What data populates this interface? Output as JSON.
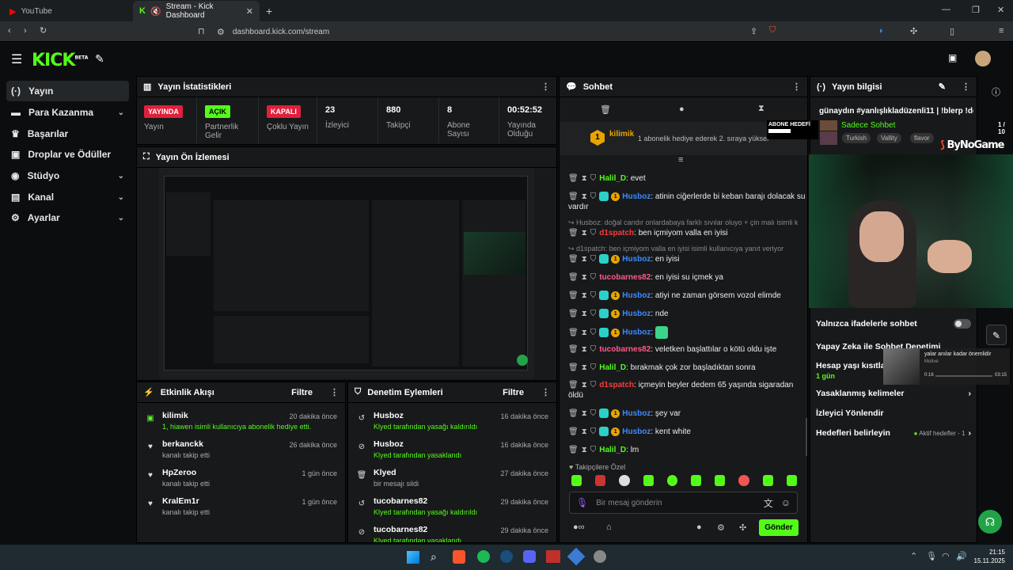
{
  "browser": {
    "tabs": [
      {
        "title": "YouTube"
      },
      {
        "title": "Stream - Kick Dashboard"
      }
    ],
    "url": "dashboard.kick.com/stream"
  },
  "header": {
    "logo": "KICK",
    "logo_badge": "BETA"
  },
  "sidebar": {
    "items": [
      {
        "label": "Yayın",
        "icon": "broadcast-icon"
      },
      {
        "label": "Para Kazanma",
        "icon": "money-icon"
      },
      {
        "label": "Başarılar",
        "icon": "trophy-icon"
      },
      {
        "label": "Droplar ve Ödüller",
        "icon": "gift-icon"
      },
      {
        "label": "Stüdyo",
        "icon": "studio-icon"
      },
      {
        "label": "Kanal",
        "icon": "channel-icon"
      },
      {
        "label": "Ayarlar",
        "icon": "gear-icon"
      }
    ]
  },
  "stats": {
    "title": "Yayın İstatistikleri",
    "cells": [
      {
        "badge": "YAYINDA",
        "label": "Yayın"
      },
      {
        "badge": "AÇIK",
        "label": "Partnerlik Gelir"
      },
      {
        "badge": "KAPALI",
        "label": "Çoklu Yayın"
      },
      {
        "value": "23",
        "label": "İzleyici"
      },
      {
        "value": "880",
        "label": "Takipçi"
      },
      {
        "value": "8",
        "label": "Abone Sayısı"
      },
      {
        "value": "00:52:52",
        "label": "Yayında Olduğu"
      }
    ]
  },
  "preview": {
    "title": "Yayın Ön İzlemesi"
  },
  "activity": {
    "title": "Etkinlik Akışı",
    "filter": "Filtre",
    "rows": [
      {
        "name": "kilimik",
        "sub": "1, hiawen isimli kullanıcıya abonelik hediye etti.",
        "time": "20 dakika önce"
      },
      {
        "name": "berkanckk",
        "sub": "kanalı takip etti",
        "time": "26 dakika önce"
      },
      {
        "name": "HpZeroo",
        "sub": "kanalı takip etti",
        "time": "1 gün önce"
      },
      {
        "name": "KralEm1r",
        "sub": "kanalı takip etti",
        "time": "1 gün önce"
      }
    ]
  },
  "moderation": {
    "title": "Denetim Eylemleri",
    "filter": "Filtre",
    "rows": [
      {
        "name": "Husboz",
        "sub": "Klyed tarafından yasağı kaldırıldı",
        "time": "16 dakika önce"
      },
      {
        "name": "Husboz",
        "sub": "Klyed tarafından yasaklandı",
        "time": "16 dakika önce"
      },
      {
        "name": "Klyed",
        "sub": "bir mesajı sildi",
        "time": "27 dakika önce"
      },
      {
        "name": "tucobarnes82",
        "sub": "Klyed tarafından yasağı kaldırıldı",
        "time": "29 dakika önce"
      },
      {
        "name": "tucobarnes82",
        "sub": "Klyed tarafından yasaklandı",
        "time": "29 dakika önce"
      }
    ]
  },
  "chat": {
    "title": "Sohbet",
    "pinned": {
      "user": "kilimik",
      "count": "1",
      "text": "1 abonelik hediye ederek 2. sıraya yüksel"
    },
    "messages": [
      {
        "user": "Halil_D",
        "color": "#53fc18",
        "text": "evet"
      },
      {
        "user": "Husboz",
        "color": "#3d8bff",
        "text": "atinin ciğerlerde bi keban barajı dolacak su vardır"
      },
      {
        "reply": "Husboz: doğal candır onlardabaya farklı sıvılar oluyo + çin malı isimli k..."
      },
      {
        "user": "d1spatch",
        "color": "#ff3b3b",
        "text": "ben içmiyom valla en iyisi"
      },
      {
        "reply": "d1spatch: ben içmiyom valla en iyisi isimli kullanıcıya yanıt veriyor"
      },
      {
        "user": "Husboz",
        "color": "#3d8bff",
        "text": "en iyisi"
      },
      {
        "user": "tucobarnes82",
        "color": "#ff5a8a",
        "text": "en iyisi su içmek ya"
      },
      {
        "user": "Husboz",
        "color": "#3d8bff",
        "text": "atiyi ne zaman görsem vozol elimde"
      },
      {
        "user": "Husboz",
        "color": "#3d8bff",
        "text": "nde"
      },
      {
        "user": "Husboz",
        "color": "#3d8bff",
        "text": ""
      },
      {
        "user": "tucobarnes82",
        "color": "#ff5a8a",
        "text": "veletken başlattılar o kötü oldu işte"
      },
      {
        "user": "Halil_D",
        "color": "#53fc18",
        "text": "bırakmak çok zor başladıktan sonra"
      },
      {
        "user": "d1spatch",
        "color": "#ff3b3b",
        "text": "içmeyin beyler dedem 65 yaşında sigaradan öldü"
      },
      {
        "user": "Husboz",
        "color": "#3d8bff",
        "text": "şey var"
      },
      {
        "user": "Husboz",
        "color": "#3d8bff",
        "text": "kent white"
      },
      {
        "user": "Halil_D",
        "color": "#53fc18",
        "text": "lm"
      }
    ],
    "followers_only": "Takipçilere Özel",
    "input_placeholder": "Bir mesaj gönderin",
    "send": "Gönder"
  },
  "info": {
    "title": "Yayın bilgisi",
    "stream_title": "günaydın #yanlışlıkladüzenli11 | !blerp !dc",
    "sub_goal": "ABONE HEDEFİ",
    "goal": "1 / 10",
    "category": "Sadece Sohbet",
    "tags": [
      "Turkish",
      "Vallity",
      "flavor"
    ],
    "overlay_brand": "ByNoGame",
    "rows": [
      {
        "label": "Yalnızca ifadelerle sohbet"
      },
      {
        "label": "Yapay Zeka ile Sohbet Denetimi"
      },
      {
        "label": "Hesap yaşı kısıtlaması",
        "sub": "1 gün"
      },
      {
        "label": "Yasaklanmış kelimeler"
      },
      {
        "label": "İzleyici Yönlendir"
      },
      {
        "label": "Hedefleri belirleyin",
        "right": "Aktif hedefler - 1"
      }
    ]
  },
  "music": {
    "title": "yalar anılar kadar önemlidir",
    "artist": "Motive",
    "elapsed": "0:16",
    "total": "03:15"
  },
  "taskbar": {
    "time": "21:15",
    "date": "15.11.2025"
  },
  "colors": {
    "accent": "#53fc18",
    "live": "#e0203c"
  }
}
